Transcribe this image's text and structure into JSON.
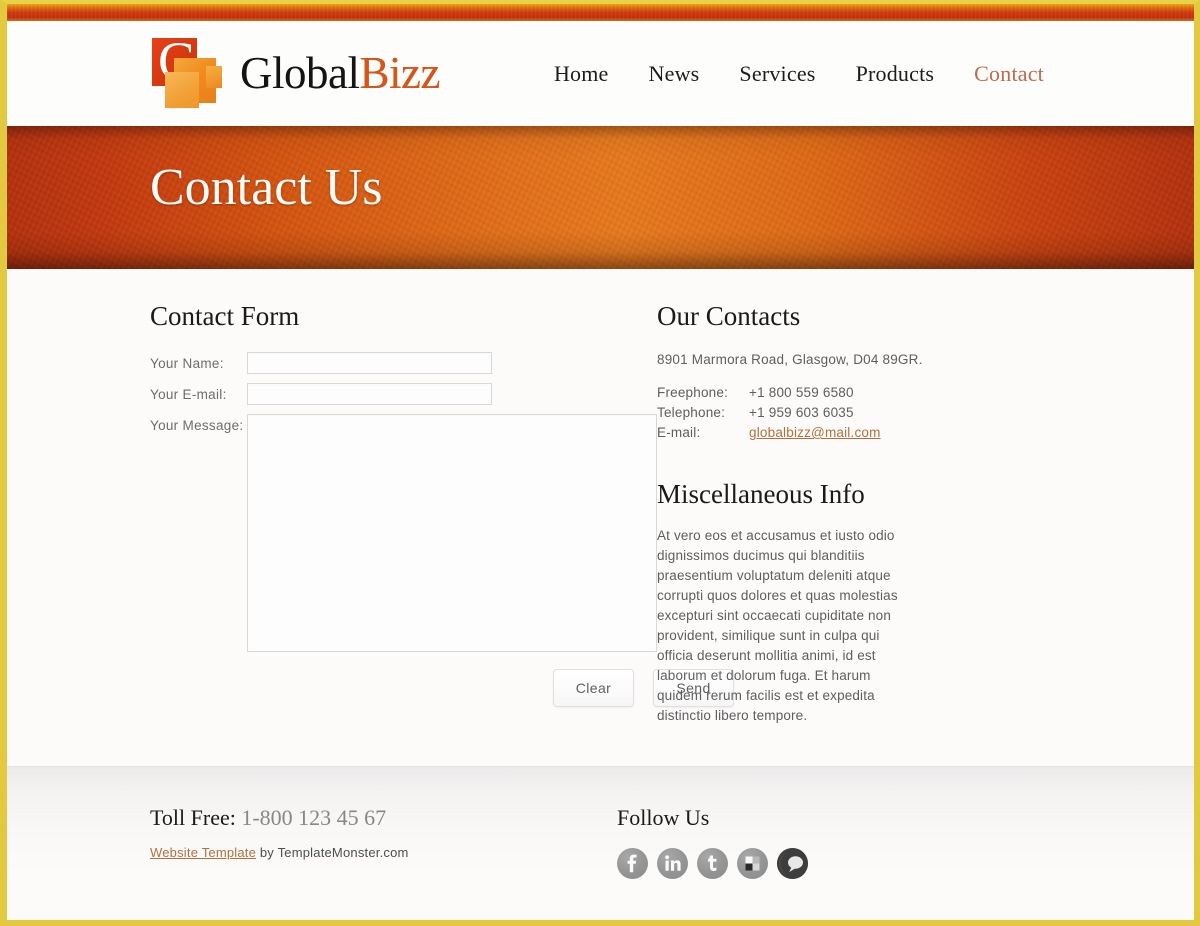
{
  "theme": {
    "frame_border": "#e2c93f",
    "accent_orange": "#e07712",
    "banner_orange": "#e4701a",
    "link_brown": "#b4703c",
    "nav_active": "#c06a4e"
  },
  "header": {
    "logo": {
      "letter": "G",
      "text_primary": "Global",
      "text_accent": "Bizz"
    },
    "nav": [
      {
        "label": "Home",
        "active": false
      },
      {
        "label": "News",
        "active": false
      },
      {
        "label": "Services",
        "active": false
      },
      {
        "label": "Products",
        "active": false
      },
      {
        "label": "Contact",
        "active": true
      }
    ]
  },
  "banner": {
    "title": "Contact Us"
  },
  "form": {
    "title": "Contact Form",
    "fields": [
      {
        "label": "Your Name:",
        "value": "",
        "placeholder": ""
      },
      {
        "label": "Your E-mail:",
        "value": "",
        "placeholder": ""
      }
    ],
    "message": {
      "label": "Your Message:",
      "value": "",
      "placeholder": ""
    },
    "buttons": {
      "clear": "Clear",
      "send": "Send"
    }
  },
  "contacts": {
    "title": "Our Contacts",
    "address": "8901 Marmora Road, Glasgow, D04 89GR.",
    "rows": [
      {
        "key": "Freephone:",
        "value": "+1 800 559 6580"
      },
      {
        "key": "Telephone:",
        "value": "+1 959 603 6035"
      }
    ],
    "email_key": "E-mail:",
    "email_value": "globalbizz@mail.com"
  },
  "misc": {
    "title": "Miscellaneous Info",
    "text": "At vero eos et accusamus et iusto odio dignissimos ducimus qui blanditiis praesentium voluptatum deleniti atque corrupti quos dolores et quas molestias excepturi sint occaecati cupiditate non provident, similique sunt in culpa qui officia deserunt mollitia animi, id est laborum et dolorum fuga. Et harum quidem rerum facilis est et expedita distinctio libero tempore."
  },
  "footer": {
    "toll_label": "Toll Free:",
    "toll_number": "1-800 123 45 67",
    "credit_link": "Website Template",
    "credit_rest": " by TemplateMonster.com",
    "watermark": "",
    "follow_title": "Follow Us",
    "social": [
      {
        "name": "facebook"
      },
      {
        "name": "linkedin"
      },
      {
        "name": "twitter"
      },
      {
        "name": "flickr"
      },
      {
        "name": "chat"
      }
    ]
  }
}
